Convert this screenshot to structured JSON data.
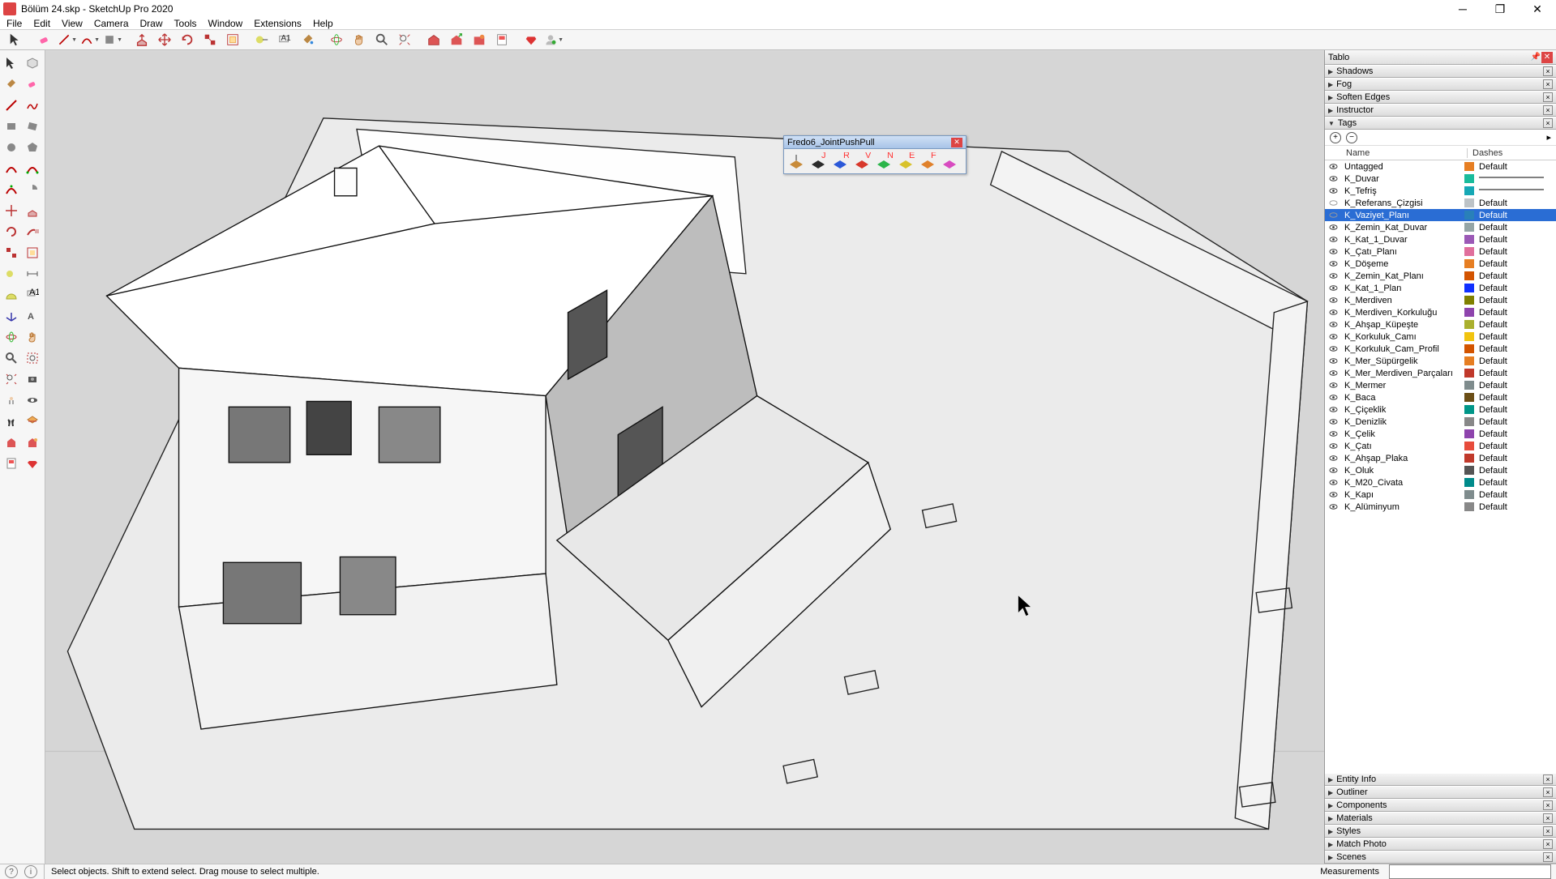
{
  "window": {
    "title": "Bölüm 24.skp - SketchUp Pro 2020"
  },
  "menu": [
    "File",
    "Edit",
    "View",
    "Camera",
    "Draw",
    "Tools",
    "Window",
    "Extensions",
    "Help"
  ],
  "tray": {
    "title": "Tablo",
    "panels_top": [
      "Shadows",
      "Fog",
      "Soften Edges",
      "Instructor"
    ],
    "tags_panel": "Tags",
    "panels_bottom": [
      "Entity Info",
      "Outliner",
      "Components",
      "Materials",
      "Styles",
      "Match Photo",
      "Scenes"
    ],
    "tags_header": {
      "name": "Name",
      "dashes": "Dashes"
    }
  },
  "tags": [
    {
      "name": "Untagged",
      "color": "#e67e22",
      "dash": "Default",
      "vis": true
    },
    {
      "name": "K_Duvar",
      "color": "#1abc9c",
      "dash": "",
      "vis": true,
      "dashline": true
    },
    {
      "name": "K_Tefriş",
      "color": "#16a8b5",
      "dash": "",
      "vis": true,
      "dashline": true
    },
    {
      "name": "K_Referans_Çizgisi",
      "color": "#bdc3c7",
      "dash": "Default",
      "vis": false
    },
    {
      "name": "K_Vaziyet_Planı",
      "color": "#2980b9",
      "dash": "Default",
      "vis": false,
      "selected": true
    },
    {
      "name": "K_Zemin_Kat_Duvar",
      "color": "#95a5a6",
      "dash": "Default",
      "vis": true
    },
    {
      "name": "K_Kat_1_Duvar",
      "color": "#9b59b6",
      "dash": "Default",
      "vis": true
    },
    {
      "name": "K_Çatı_Planı",
      "color": "#e06f9c",
      "dash": "Default",
      "vis": true
    },
    {
      "name": "K_Döşeme",
      "color": "#e67e22",
      "dash": "Default",
      "vis": true
    },
    {
      "name": "K_Zemin_Kat_Planı",
      "color": "#d35400",
      "dash": "Default",
      "vis": true
    },
    {
      "name": "K_Kat_1_Plan",
      "color": "#1030ff",
      "dash": "Default",
      "vis": true
    },
    {
      "name": "K_Merdiven",
      "color": "#808000",
      "dash": "Default",
      "vis": true
    },
    {
      "name": "K_Merdiven_Korkuluğu",
      "color": "#8e44ad",
      "dash": "Default",
      "vis": true
    },
    {
      "name": "K_Ahşap_Küpeşte",
      "color": "#aab02e",
      "dash": "Default",
      "vis": true
    },
    {
      "name": "K_Korkuluk_Camı",
      "color": "#f1c40f",
      "dash": "Default",
      "vis": true
    },
    {
      "name": "K_Korkuluk_Cam_Profil",
      "color": "#d35400",
      "dash": "Default",
      "vis": true
    },
    {
      "name": "K_Mer_Süpürgelik",
      "color": "#e67e22",
      "dash": "Default",
      "vis": true
    },
    {
      "name": "K_Mer_Merdiven_Parçaları",
      "color": "#c0392b",
      "dash": "Default",
      "vis": true
    },
    {
      "name": "K_Mermer",
      "color": "#7f8c8d",
      "dash": "Default",
      "vis": true
    },
    {
      "name": "K_Baca",
      "color": "#6b4e16",
      "dash": "Default",
      "vis": true
    },
    {
      "name": "K_Çiçeklik",
      "color": "#009688",
      "dash": "Default",
      "vis": true
    },
    {
      "name": "K_Denizlik",
      "color": "#888888",
      "dash": "Default",
      "vis": true
    },
    {
      "name": "K_Çelik",
      "color": "#8e44ad",
      "dash": "Default",
      "vis": true
    },
    {
      "name": "K_Çatı",
      "color": "#e74c3c",
      "dash": "Default",
      "vis": true
    },
    {
      "name": "K_Ahşap_Plaka",
      "color": "#c0392b",
      "dash": "Default",
      "vis": true
    },
    {
      "name": "K_Oluk",
      "color": "#555555",
      "dash": "Default",
      "vis": true
    },
    {
      "name": "K_M20_Civata",
      "color": "#008b8b",
      "dash": "Default",
      "vis": true
    },
    {
      "name": "K_Kapı",
      "color": "#7f8c8d",
      "dash": "Default",
      "vis": true
    },
    {
      "name": "K_Alüminyum",
      "color": "#888888",
      "dash": "Default",
      "vis": true
    }
  ],
  "floating": {
    "title": "Fredo6_JointPushPull"
  },
  "status": {
    "hint": "Select objects. Shift to extend select. Drag mouse to select multiple.",
    "meas_label": "Measurements"
  }
}
